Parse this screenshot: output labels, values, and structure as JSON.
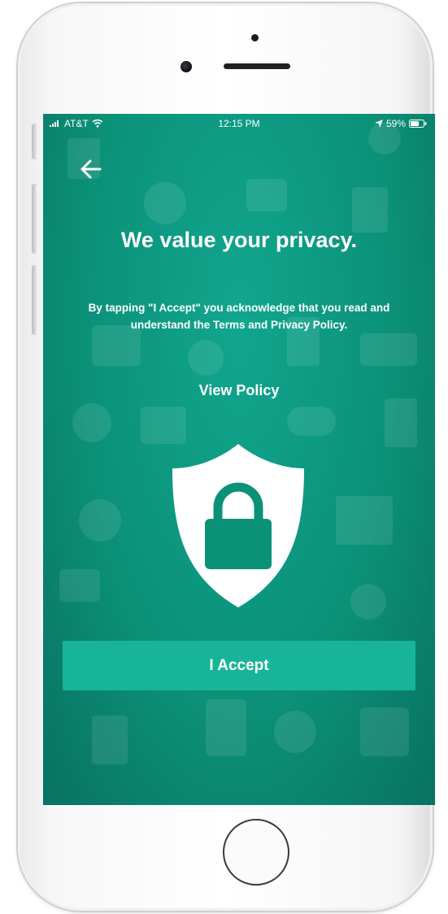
{
  "status_bar": {
    "carrier": "AT&T",
    "time": "12:15 PM",
    "battery": "59%"
  },
  "screen": {
    "title": "We value your privacy.",
    "description": "By tapping \"I Accept\" you acknowledge that you read and understand the Terms and Privacy Policy.",
    "view_policy_label": "View Policy",
    "accept_label": "I Accept"
  },
  "icons": {
    "back": "arrow-left-icon",
    "shield": "shield-lock-icon",
    "wifi": "wifi-icon",
    "signal": "signal-icon",
    "location": "location-arrow-icon",
    "battery": "battery-icon"
  },
  "colors": {
    "background": "#0c9179",
    "button": "#18b49a",
    "text": "#ffffff"
  }
}
